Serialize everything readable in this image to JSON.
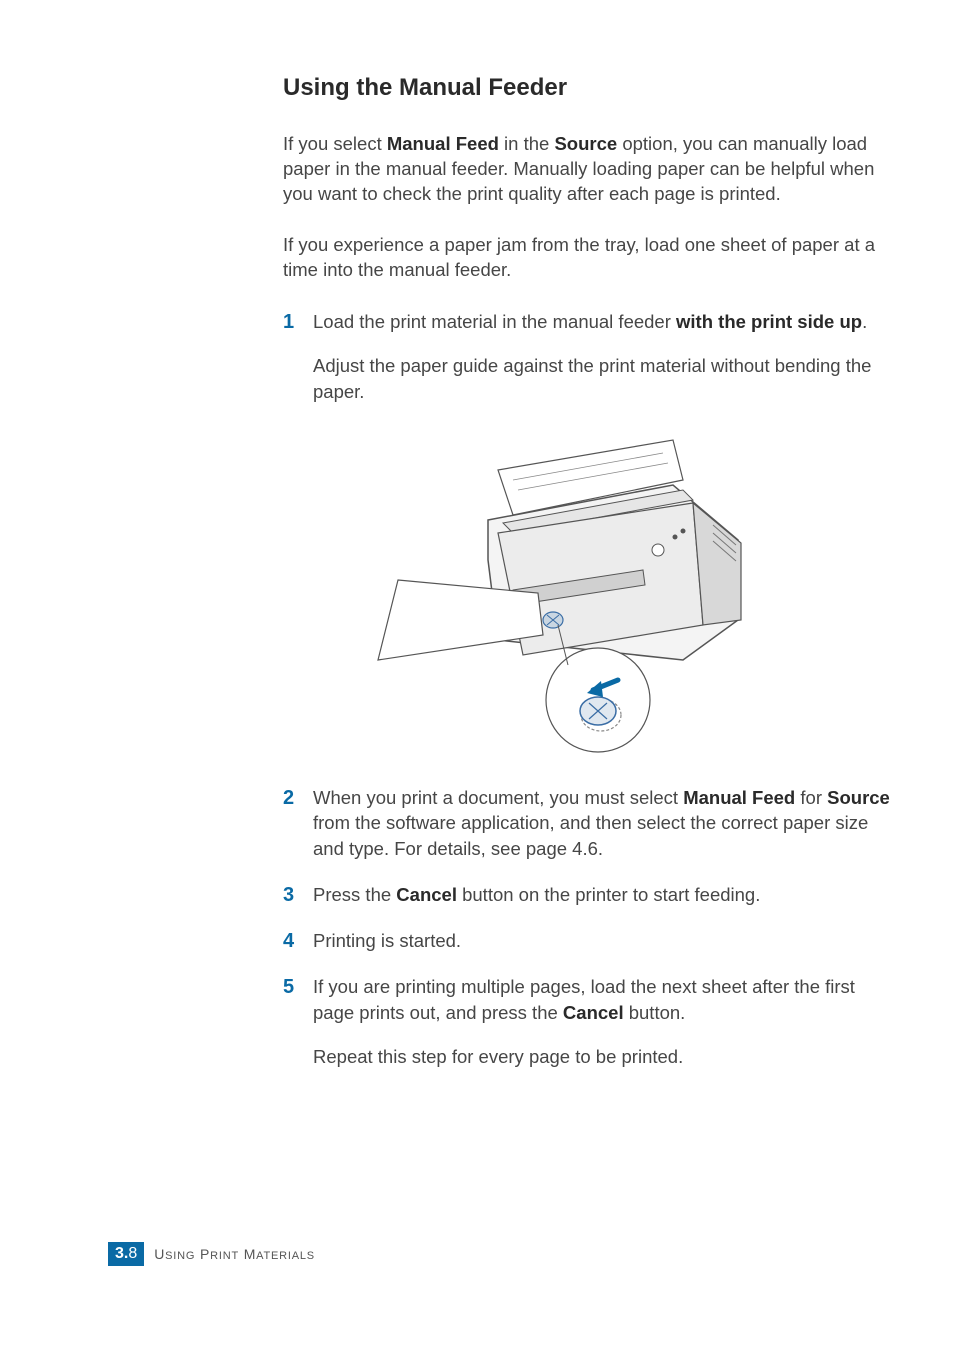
{
  "title": "Using the Manual Feeder",
  "intro1_parts": [
    "If you select ",
    "Manual Feed",
    " in the ",
    "Source",
    " option, you can manually load paper in the manual feeder. Manually loading paper can be helpful when you want to check the print quality after each page is printed."
  ],
  "intro2": "If you experience a paper jam from the tray, load one sheet of paper at a time into the manual feeder.",
  "steps": {
    "s1": {
      "num": "1",
      "p1_parts": [
        "Load the print material in the manual feeder ",
        "with the print side up",
        "."
      ],
      "p2": "Adjust the paper guide against the print material without bending the paper."
    },
    "s2": {
      "num": "2",
      "p1_parts": [
        "When you print a document, you must select ",
        "Manual Feed",
        " for ",
        "Source",
        " from the software application, and then select the correct paper size and type. For details, see page 4.6."
      ]
    },
    "s3": {
      "num": "3",
      "p1_parts": [
        "Press the ",
        "Cancel",
        " button on the printer to start feeding."
      ]
    },
    "s4": {
      "num": "4",
      "p1": "Printing is started."
    },
    "s5": {
      "num": "5",
      "p1_parts": [
        "If you are printing multiple pages, load the next sheet after the first page prints out, and press the ",
        "Cancel",
        " button."
      ],
      "p2": "Repeat this step for every page to be printed."
    }
  },
  "footer": {
    "chapter": "3.",
    "page": "8",
    "label_main": "U",
    "label_rest": "SING",
    "label_main2": "P",
    "label_rest2": "RINT",
    "label_main3": "M",
    "label_rest3": "ATERIALS"
  }
}
